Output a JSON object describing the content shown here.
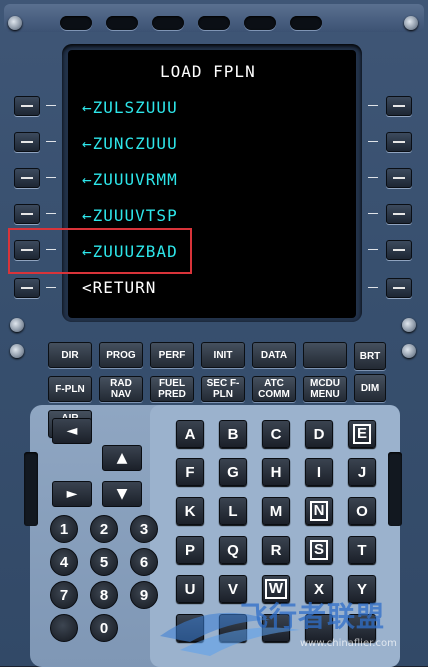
{
  "screen": {
    "title": "LOAD FPLN",
    "lines": [
      {
        "text": "←ZULSZUUU",
        "color": "cyan"
      },
      {
        "text": "←ZUNCZUUU",
        "color": "cyan"
      },
      {
        "text": "←ZUUUVRMM",
        "color": "cyan"
      },
      {
        "text": "←ZUUUVTSP",
        "color": "cyan"
      },
      {
        "text": "←ZUUUZBAD",
        "color": "cyan"
      },
      {
        "text": "<RETURN",
        "color": "white"
      }
    ]
  },
  "function_keys": {
    "dir": "DIR",
    "prog": "PROG",
    "perf": "PERF",
    "init": "INIT",
    "data": "DATA",
    "blank": "",
    "brt": "BRT",
    "fpln": "F-PLN",
    "rad_nav": "RAD NAV",
    "fuel_pred": "FUEL PRED",
    "sec_fpln": "SEC F-PLN",
    "atc_comm": "ATC COMM",
    "mcdu_menu": "MCDU MENU",
    "dim": "DIM",
    "airport": "AIR PORT"
  },
  "alpha_keys": [
    "A",
    "B",
    "C",
    "D",
    "E",
    "F",
    "G",
    "H",
    "I",
    "J",
    "K",
    "L",
    "M",
    "N",
    "O",
    "P",
    "Q",
    "R",
    "S",
    "T",
    "U",
    "V",
    "W",
    "X",
    "Y"
  ],
  "num_keys": [
    "1",
    "2",
    "3",
    "4",
    "5",
    "6",
    "7",
    "8",
    "9",
    "0"
  ],
  "arrows": {
    "left": "◄",
    "up": "▲",
    "right": "►",
    "down": "▼"
  },
  "watermark": {
    "text": "飞行者联盟",
    "url": "www.chinaflier.com"
  },
  "colors": {
    "cyan": "#2ee6ea",
    "highlight": "#d9343a"
  }
}
